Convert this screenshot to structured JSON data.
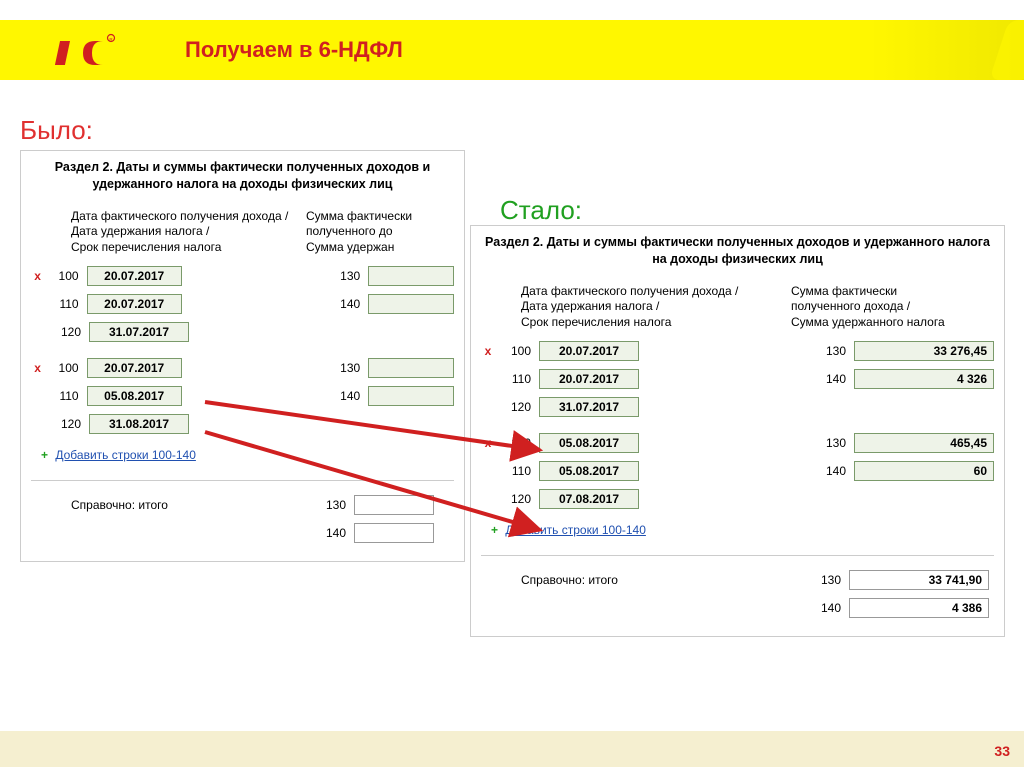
{
  "header": {
    "title": "Получаем в 6-НДФЛ"
  },
  "labels": {
    "before": "Было:",
    "after": "Стало:"
  },
  "section_title": "Раздел 2.  Даты и суммы фактически полученных доходов и удержанного налога на доходы физических лиц",
  "col": {
    "dates": "Дата фактического получения дохода /\nДата удержания налога /\nСрок перечисления налога",
    "sums_short": "Сумма фактически\nполученного до\nСумма удержан",
    "sums_full": "Сумма фактически\nполученного дохода /\nСумма удержанного налога"
  },
  "codes": {
    "c100": "100",
    "c110": "110",
    "c120": "120",
    "c130": "130",
    "c140": "140"
  },
  "before": {
    "block1": {
      "d100": "20.07.2017",
      "d110": "20.07.2017",
      "d120": "31.07.2017"
    },
    "block2": {
      "d100": "20.07.2017",
      "d110": "05.08.2017",
      "d120": "31.08.2017"
    }
  },
  "after": {
    "block1": {
      "d100": "20.07.2017",
      "d110": "20.07.2017",
      "d120": "31.07.2017",
      "s130": "33 276,45",
      "s140": "4 326"
    },
    "block2": {
      "d100": "05.08.2017",
      "d110": "05.08.2017",
      "d120": "07.08.2017",
      "s130": "465,45",
      "s140": "60"
    },
    "summary": {
      "s130": "33 741,90",
      "s140": "4 386"
    }
  },
  "add_link": "Добавить строки 100-140",
  "summary_label": "Справочно: итого",
  "page_number": "33"
}
